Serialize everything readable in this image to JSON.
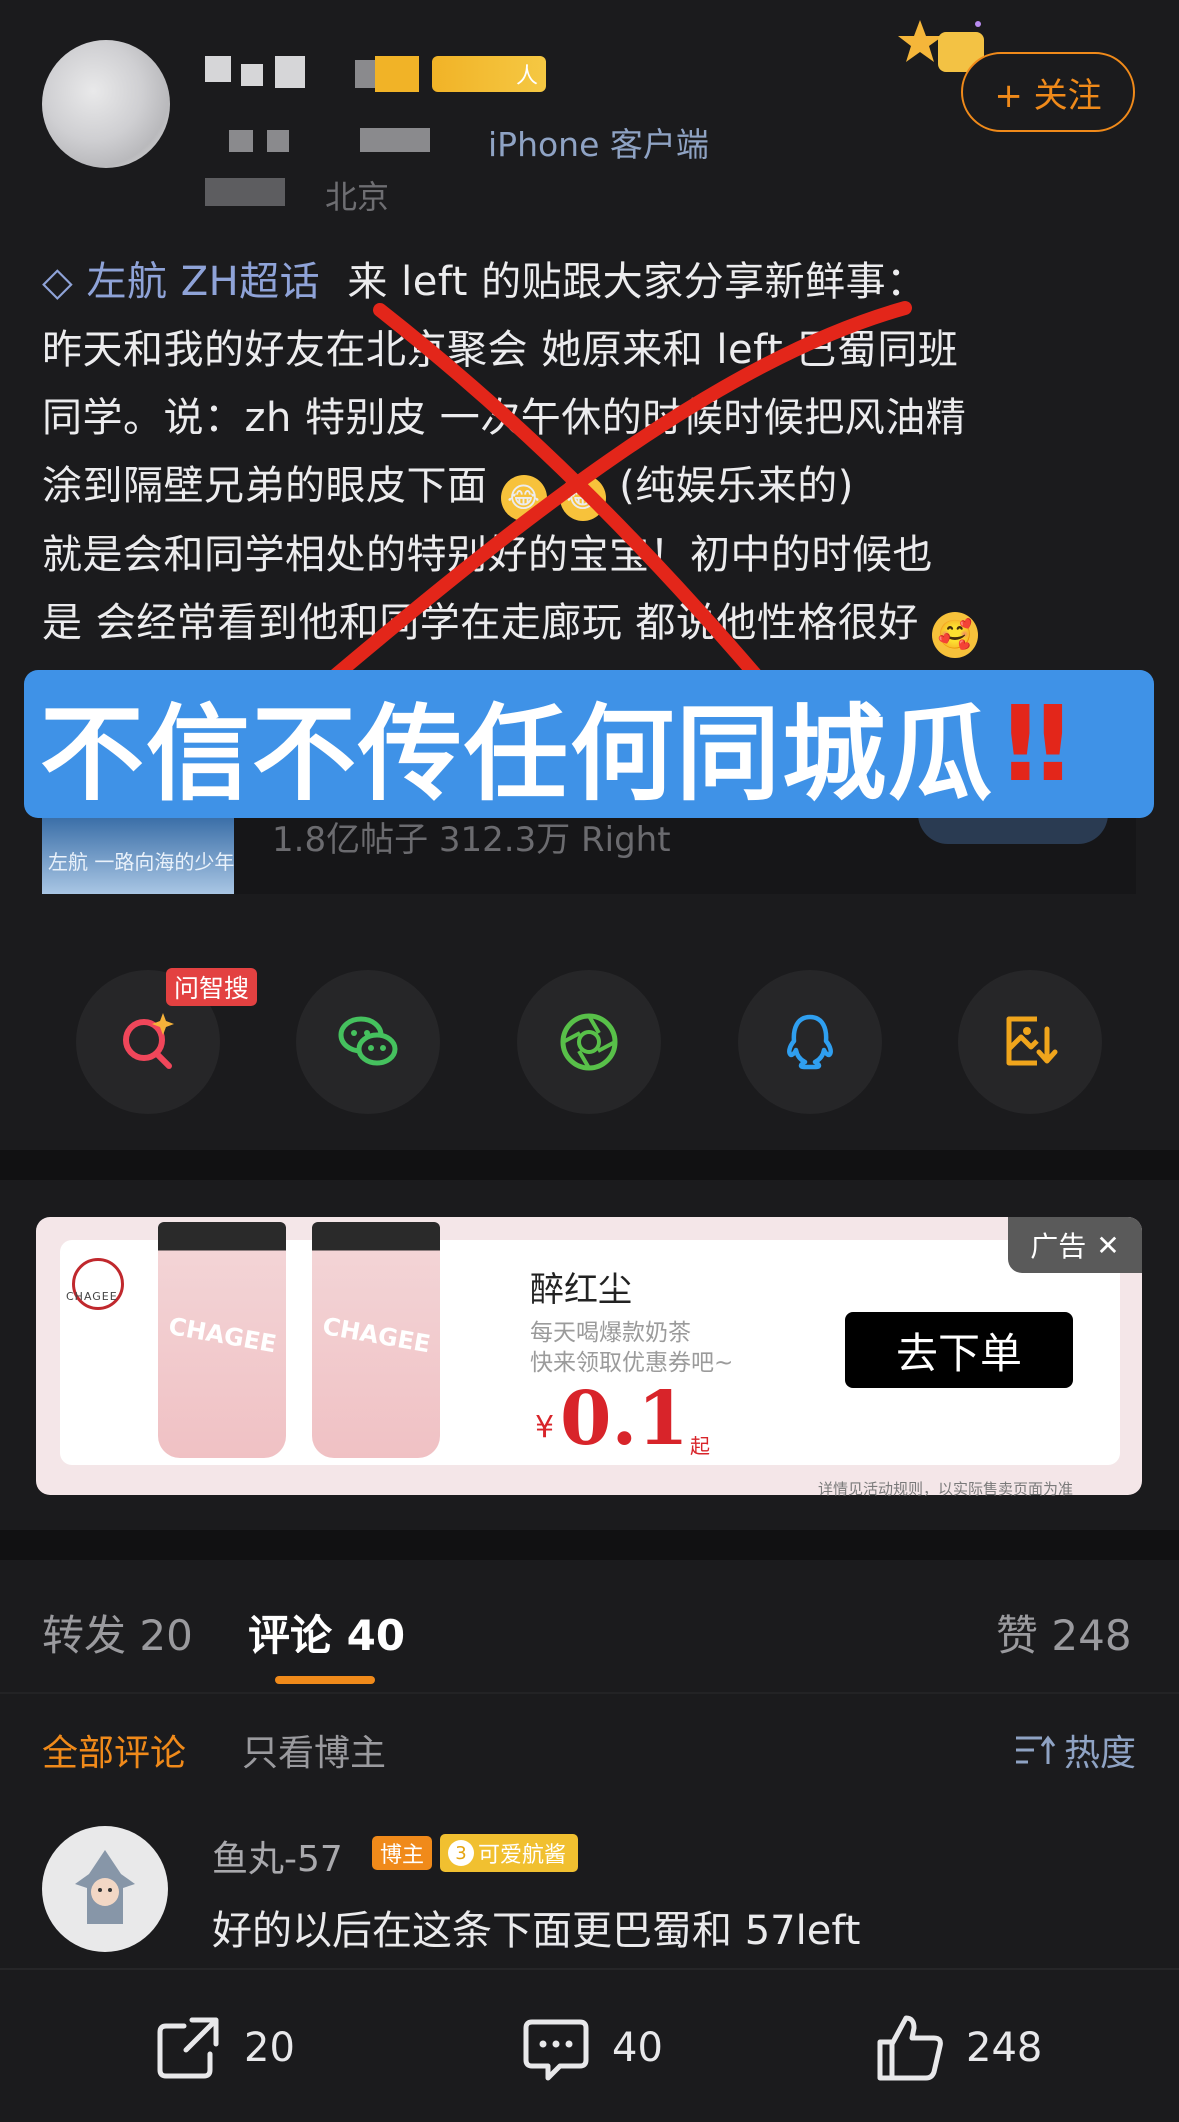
{
  "header": {
    "vip_badge_text": "人",
    "source_text": "iPhone 客户端",
    "location_text": "北京",
    "follow_label": "+ 关注"
  },
  "post": {
    "topic": "左航 ZH超话",
    "lines": [
      "来 left 的贴跟大家分享新鲜事：",
      "昨天和我的好友在北京聚会 她原来和 left 巴蜀同班",
      "同学。说：zh 特别皮 一次午休的时候时候把风油精",
      "涂到隔壁兄弟的眼皮下面",
      "(纯娱乐来的)",
      "就是会和同学相处的特别好的宝宝！初中的时候也",
      "是 会经常看到他和同学在走廊玩 都说他性格很好"
    ]
  },
  "overlay": {
    "banner_text": "不信不传任何同城瓜",
    "banner_mark": "‼"
  },
  "supertopic": {
    "thumb_text": "左航 一路向海的少年",
    "stats": "1.8亿帖子 312.3万 Right"
  },
  "share": {
    "ai_tag": "问智搜",
    "icons": [
      "ai-search-icon",
      "wechat-icon",
      "moments-icon",
      "qq-icon",
      "save-image-icon"
    ]
  },
  "ad": {
    "tag": "广告",
    "logo_text": "CHAGEE",
    "cup_brand": "CHAGEE",
    "title": "醉红尘",
    "desc_line1": "每天喝爆款奶茶",
    "desc_line2": "快来领取优惠券吧~",
    "price_symbol": "¥",
    "price": "0.1",
    "price_suffix": "起",
    "cta": "去下单",
    "fine_print": "详情见活动规则，以实际售卖页面为准"
  },
  "tabs": {
    "repost": {
      "label": "转发",
      "count": "20"
    },
    "comments": {
      "label": "评论",
      "count": "40"
    },
    "likes": {
      "label": "赞",
      "count": "248"
    }
  },
  "filters": {
    "all": "全部评论",
    "author_only": "只看博主",
    "sort": "热度"
  },
  "comment": {
    "name": "鱼丸-57",
    "owner_badge": "博主",
    "fan_level": "3",
    "fan_badge": "可爱航酱",
    "text": "好的以后在这条下面更巴蜀和 57left"
  },
  "bottom_bar": {
    "repost_count": "20",
    "comment_count": "40",
    "like_count": "248"
  },
  "colors": {
    "accent": "#f08a1a",
    "topic_link": "#8fa3d8",
    "banner_bg": "#3f92e7",
    "cross_red": "#e3261a"
  }
}
